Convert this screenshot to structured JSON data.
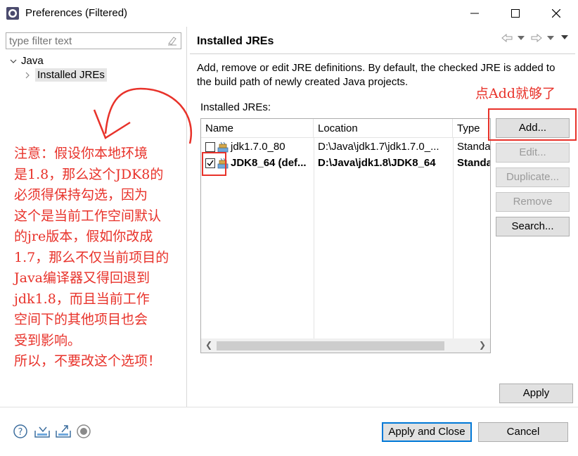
{
  "window": {
    "title": "Preferences (Filtered)"
  },
  "left": {
    "filter_placeholder": "type filter text",
    "tree": {
      "java_label": "Java",
      "installed_jres_label": "Installed JREs"
    }
  },
  "annotations": {
    "note_main": "注意：假设你本地环境\n是1.8，那么这个JDK8的\n必须得保持勾选，因为\n这个是当前工作空间默认\n的jre版本，假如你改成\n1.7，那么不仅当前项目的\nJava编译器又得回退到\njdk1.8，而且当前工作\n空间下的其他项目也会\n受到影响。\n所以，不要改这个选项！",
    "note_add": "点Add就够了"
  },
  "page": {
    "title": "Installed JREs",
    "description": "Add, remove or edit JRE definitions. By default, the checked JRE is added to the build path of newly created Java projects.",
    "list_label": "Installed JREs:"
  },
  "table": {
    "columns": [
      "Name",
      "Location",
      "Type"
    ],
    "rows": [
      {
        "name": "jdk1.7.0_80",
        "location": "D:\\Java\\jdk1.7\\jdk1.7.0_...",
        "type": "Standa",
        "checked": false,
        "bold": false
      },
      {
        "name": "JDK8_64 (def...",
        "location": "D:\\Java\\jdk1.8\\JDK8_64",
        "type": "Standa",
        "checked": true,
        "bold": true
      }
    ]
  },
  "buttons": {
    "add": "Add...",
    "edit": "Edit...",
    "duplicate": "Duplicate...",
    "remove": "Remove",
    "search": "Search...",
    "apply": "Apply",
    "apply_close": "Apply and Close",
    "cancel": "Cancel"
  },
  "colors": {
    "annotation_red": "#e8322a",
    "focus_blue": "#0078d7"
  }
}
